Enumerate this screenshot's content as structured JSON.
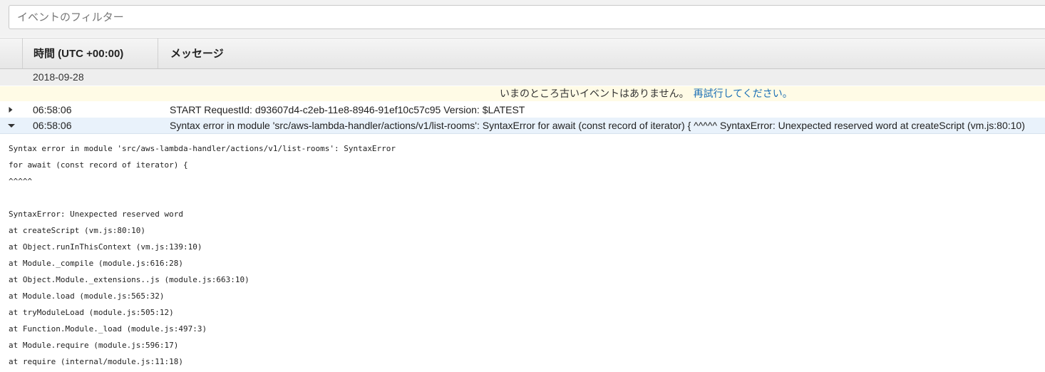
{
  "filter": {
    "placeholder": "イベントのフィルター"
  },
  "columns": {
    "time": "時間 (UTC +00:00)",
    "message": "メッセージ"
  },
  "date_group": "2018-09-28",
  "notice": {
    "text": "いまのところ古いイベントはありません。",
    "link": "再試行してください。"
  },
  "events": [
    {
      "time": "06:58:06",
      "message": "START RequestId: d93607d4-c2eb-11e8-8946-91ef10c57c95 Version: $LATEST",
      "expanded": false
    },
    {
      "time": "06:58:06",
      "message": "Syntax error in module 'src/aws-lambda-handler/actions/v1/list-rooms': SyntaxError for await (const record of iterator) { ^^^^^ SyntaxError: Unexpected reserved word at createScript (vm.js:80:10)",
      "expanded": true
    }
  ],
  "detail_lines": [
    "Syntax error in module 'src/aws-lambda-handler/actions/v1/list-rooms': SyntaxError",
    "for await (const record of iterator) {",
    "^^^^^",
    "",
    "SyntaxError: Unexpected reserved word",
    "at createScript (vm.js:80:10)",
    "at Object.runInThisContext (vm.js:139:10)",
    "at Module._compile (module.js:616:28)",
    "at Object.Module._extensions..js (module.js:663:10)",
    "at Module.load (module.js:565:32)",
    "at tryModuleLoad (module.js:505:12)",
    "at Function.Module._load (module.js:497:3)",
    "at Module.require (module.js:596:17)",
    "at require (internal/module.js:11:18)"
  ]
}
